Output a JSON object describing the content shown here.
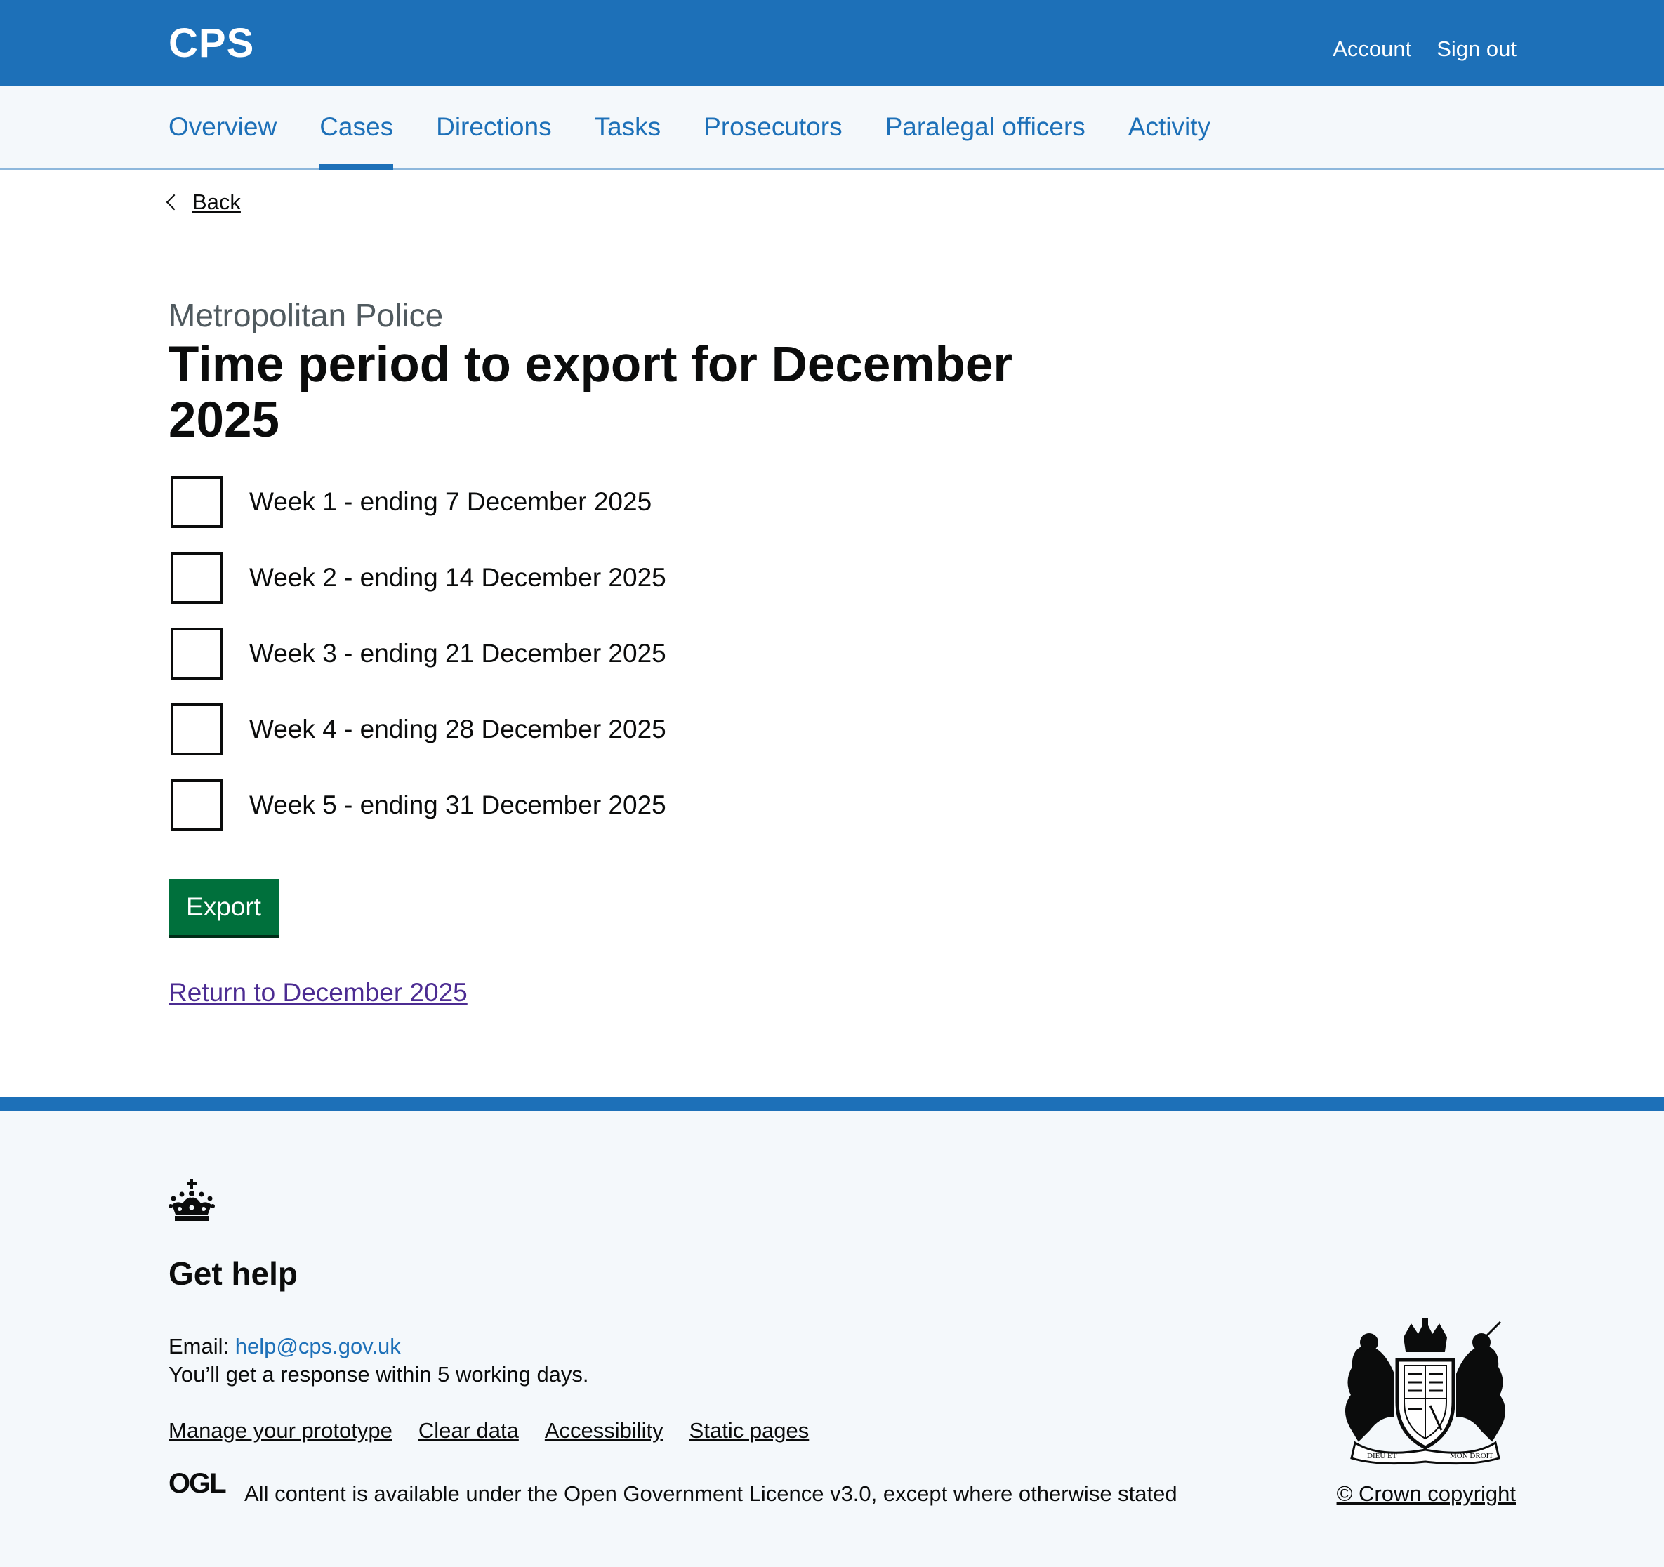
{
  "header": {
    "logo": "CPS",
    "links": [
      "Account",
      "Sign out"
    ]
  },
  "nav": {
    "items": [
      "Overview",
      "Cases",
      "Directions",
      "Tasks",
      "Prosecutors",
      "Paralegal officers",
      "Activity"
    ],
    "active": "Cases"
  },
  "back_link": "Back",
  "caption": "Metropolitan Police",
  "heading": "Time period to export for December 2025",
  "checkboxes": [
    {
      "label": "Week 1 - ending 7 December 2025",
      "checked": false
    },
    {
      "label": "Week 2 - ending 14 December 2025",
      "checked": false
    },
    {
      "label": "Week 3 - ending 21 December 2025",
      "checked": false
    },
    {
      "label": "Week 4 - ending 28 December 2025",
      "checked": false
    },
    {
      "label": "Week 5 - ending 31 December 2025",
      "checked": false
    }
  ],
  "export_button": "Export",
  "return_link": "Return to December 2025",
  "footer": {
    "get_help": "Get help",
    "email_label": "Email:",
    "email": "help@cps.gov.uk",
    "response": "You’ll get a response within 5 working days.",
    "links": [
      "Manage your prototype",
      "Clear data",
      "Accessibility",
      "Static pages"
    ],
    "ogl_logo_text": "OGL",
    "licence_prefix": "All content is available under the",
    "licence_link": "Open Government Licence v3.0",
    "licence_suffix": ", except where otherwise stated",
    "coat_of_arms_text": [
      "DIEU ET",
      "MON DROIT"
    ],
    "copyright": "© Crown copyright"
  },
  "colors": {
    "brand_blue": "#1d70b8",
    "button_green": "#00703c",
    "visited_link": "#4c2c92",
    "footer_bg": "#f4f8fb"
  },
  "icons": [
    "chevron-left-icon",
    "crown-icon",
    "ogl-logo",
    "royal-coat-of-arms"
  ]
}
